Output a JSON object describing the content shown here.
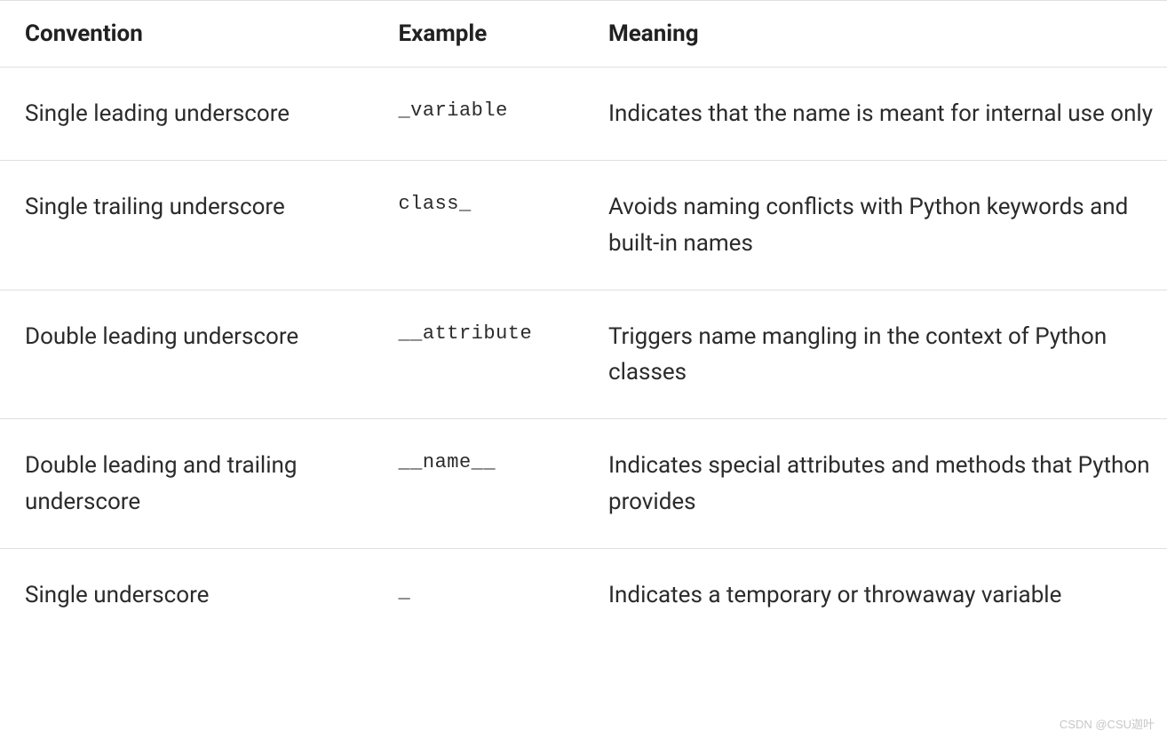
{
  "table": {
    "headers": {
      "convention": "Convention",
      "example": "Example",
      "meaning": "Meaning"
    },
    "rows": [
      {
        "convention": "Single leading underscore",
        "example": "_variable",
        "meaning": "Indicates that the name is meant for internal use only"
      },
      {
        "convention": "Single trailing underscore",
        "example": "class_",
        "meaning": "Avoids naming conflicts with Python keywords and built-in names"
      },
      {
        "convention": "Double leading underscore",
        "example": "__attribute",
        "meaning": "Triggers name mangling in the context of Python classes"
      },
      {
        "convention": "Double leading and trailing underscore",
        "example": "__name__",
        "meaning": "Indicates special attributes and methods that Python provides"
      },
      {
        "convention": "Single underscore",
        "example": "_",
        "meaning": "Indicates a temporary or throwaway variable"
      }
    ]
  },
  "watermark": "CSDN @CSU迦叶"
}
